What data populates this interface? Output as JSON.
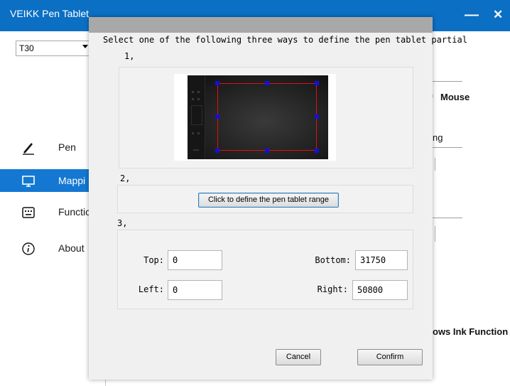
{
  "app": {
    "title": "VEIKK Pen Tablet",
    "minimize_glyph": "—",
    "close_glyph": "✕",
    "model_selected": "T30"
  },
  "sidebar": {
    "items": [
      {
        "label": "Pen",
        "icon": "pen-icon",
        "active": false
      },
      {
        "label": "Mappi",
        "icon": "monitor-icon",
        "active": true
      },
      {
        "label": "Functic",
        "icon": "keyboard-icon",
        "active": false
      },
      {
        "label": "About",
        "icon": "info-icon",
        "active": false
      }
    ]
  },
  "background_fragments": {
    "mouse": "Mouse",
    "ng": "ng",
    "windows_ink": "ows Ink Function"
  },
  "dialog": {
    "heading": "Select one of the following three ways to define the pen tablet partial",
    "step1_label": "1,",
    "step2_label": "2,",
    "step3_label": "3,",
    "define_range_button": "Click to define the pen tablet range",
    "fields": {
      "top_label": "Top:",
      "top_value": "0",
      "bottom_label": "Bottom:",
      "bottom_value": "31750",
      "left_label": "Left:",
      "left_value": "0",
      "right_label": "Right:",
      "right_value": "50800"
    },
    "cancel_button": "Cancel",
    "confirm_button": "Confirm"
  },
  "colors": {
    "titlebar": "#0b6fc4",
    "active_nav": "#1478d2",
    "selection_border": "#e01010",
    "selection_handle": "#1010e0"
  }
}
